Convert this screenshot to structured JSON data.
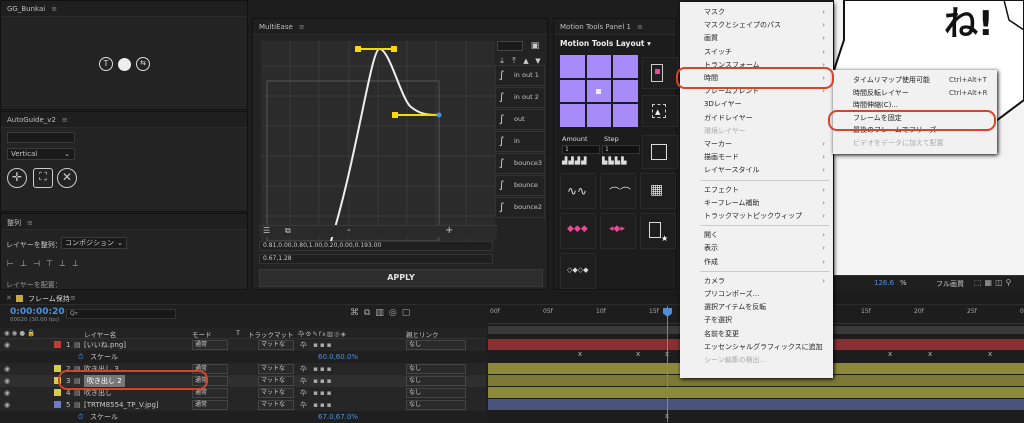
{
  "panels": {
    "gg": "GG_Bunkai",
    "autoguide": "AutoGuide_v2",
    "seiretsu": "整列",
    "multiease": "MultiEase",
    "motiontools": "Motion Tools Panel 1"
  },
  "autoguide": {
    "orientation": "Vertical"
  },
  "align": {
    "label": "レイヤーを整列：",
    "target": "コンポジション",
    "dist_label": "レイヤーを配置："
  },
  "multiease": {
    "presets": [
      "in out 1",
      "in out 2",
      "out",
      "in",
      "bounce3",
      "bounce",
      "bounce2"
    ],
    "minus": "-",
    "plus": "+",
    "bezier1": "0.81,0.00,0.80,1.00,0.20,0.00,0.193.00",
    "bezier2": "0.67,1.28",
    "apply": "APPLY"
  },
  "motiontools": {
    "layout": "Motion Tools Layout",
    "amount": "Amount",
    "step": "Step",
    "amount_val": "1",
    "step_val": "1"
  },
  "viewer": {
    "zoom": "126.6",
    "unit": "%",
    "quality": "フル画質"
  },
  "timeline": {
    "tab": "フレーム保持",
    "time": "0:00:00:20",
    "fps": "00020 (30.00 fps)",
    "search": "Q▿",
    "headers": {
      "name": "レイヤー名",
      "mode": "モード",
      "t": "T",
      "trackmatte": "トラックマット",
      "parent": "親とリンク"
    },
    "ruler": [
      "00f",
      "05f",
      "10f",
      "15f",
      "20f",
      "05f",
      "10f",
      "15f",
      "20f",
      "25f",
      "02:0"
    ],
    "rows": [
      {
        "num": "1",
        "name": "[いいね.png]",
        "mode": "通常",
        "matte": "マットな",
        "parent": "なし",
        "color": "#c23b3b",
        "sub": false
      },
      {
        "num": "",
        "name": "スケール",
        "value": "60.0,60.0%",
        "sub": true
      },
      {
        "num": "2",
        "name": "吹き出し 3",
        "mode": "通常",
        "matte": "マットな",
        "parent": "なし",
        "color": "#d6cc49",
        "sub": false
      },
      {
        "num": "3",
        "name": "吹き出し 2",
        "mode": "通常",
        "matte": "マットな",
        "parent": "なし",
        "color": "#d6cc49",
        "sub": false,
        "selected": true
      },
      {
        "num": "4",
        "name": "吹き出し",
        "mode": "通常",
        "matte": "マットな",
        "parent": "なし",
        "color": "#d6cc49",
        "sub": false
      },
      {
        "num": "5",
        "name": "[TRTM8554_TP_V.jpg]",
        "mode": "通常",
        "matte": "マットな",
        "parent": "なし",
        "color": "#6c7cc4",
        "sub": false
      },
      {
        "num": "",
        "name": "スケール",
        "value": "67.0,67.0%",
        "sub": true
      }
    ]
  },
  "context_menu": {
    "items": [
      {
        "label": "マスク",
        "arrow": true
      },
      {
        "label": "マスクとシェイプのパス",
        "arrow": true
      },
      {
        "label": "画質",
        "arrow": true
      },
      {
        "label": "スイッチ",
        "arrow": true
      },
      {
        "label": "トランスフォーム",
        "arrow": true
      },
      {
        "label": "時間",
        "arrow": true
      },
      {
        "label": "フレームブレンド",
        "arrow": true
      },
      {
        "label": "3Dレイヤー"
      },
      {
        "label": "ガイドレイヤー"
      },
      {
        "label": "環境レイヤー",
        "disabled": true
      },
      {
        "label": "マーカー",
        "arrow": true
      },
      {
        "label": "描画モード",
        "arrow": true
      },
      {
        "label": "レイヤースタイル",
        "arrow": true
      },
      {
        "label": "エフェクト",
        "arrow": true
      },
      {
        "label": "キーフレーム補助",
        "arrow": true
      },
      {
        "label": "トラックマットピックウィップ",
        "arrow": true
      },
      {
        "label": "開く",
        "arrow": true
      },
      {
        "label": "表示",
        "arrow": true
      },
      {
        "label": "作成",
        "arrow": true
      },
      {
        "label": "カメラ",
        "arrow": true
      },
      {
        "label": "プリコンポーズ..."
      },
      {
        "label": "選択アイテムを反転"
      },
      {
        "label": "子を選択"
      },
      {
        "label": "名前を変更"
      },
      {
        "label": "エッセンシャルグラフィックスに追加"
      },
      {
        "label": "シーン編集の検出...",
        "disabled": true
      }
    ]
  },
  "submenu": {
    "items": [
      {
        "label": "タイムリマップ使用可能",
        "shortcut": "Ctrl+Alt+T"
      },
      {
        "label": "時間反転レイヤー",
        "shortcut": "Ctrl+Alt+R"
      },
      {
        "label": "時間伸縮(C)..."
      },
      {
        "label": "フレームを固定"
      },
      {
        "label": "最後のフレームでフリーズ"
      },
      {
        "label": "ビデオをデータに加えて配置",
        "disabled": true
      }
    ]
  },
  "colors": {
    "accent": "#d8432a",
    "purple": "#a78bfa",
    "yellow": "#f5d90a",
    "playhead": "#4f8fd9"
  }
}
